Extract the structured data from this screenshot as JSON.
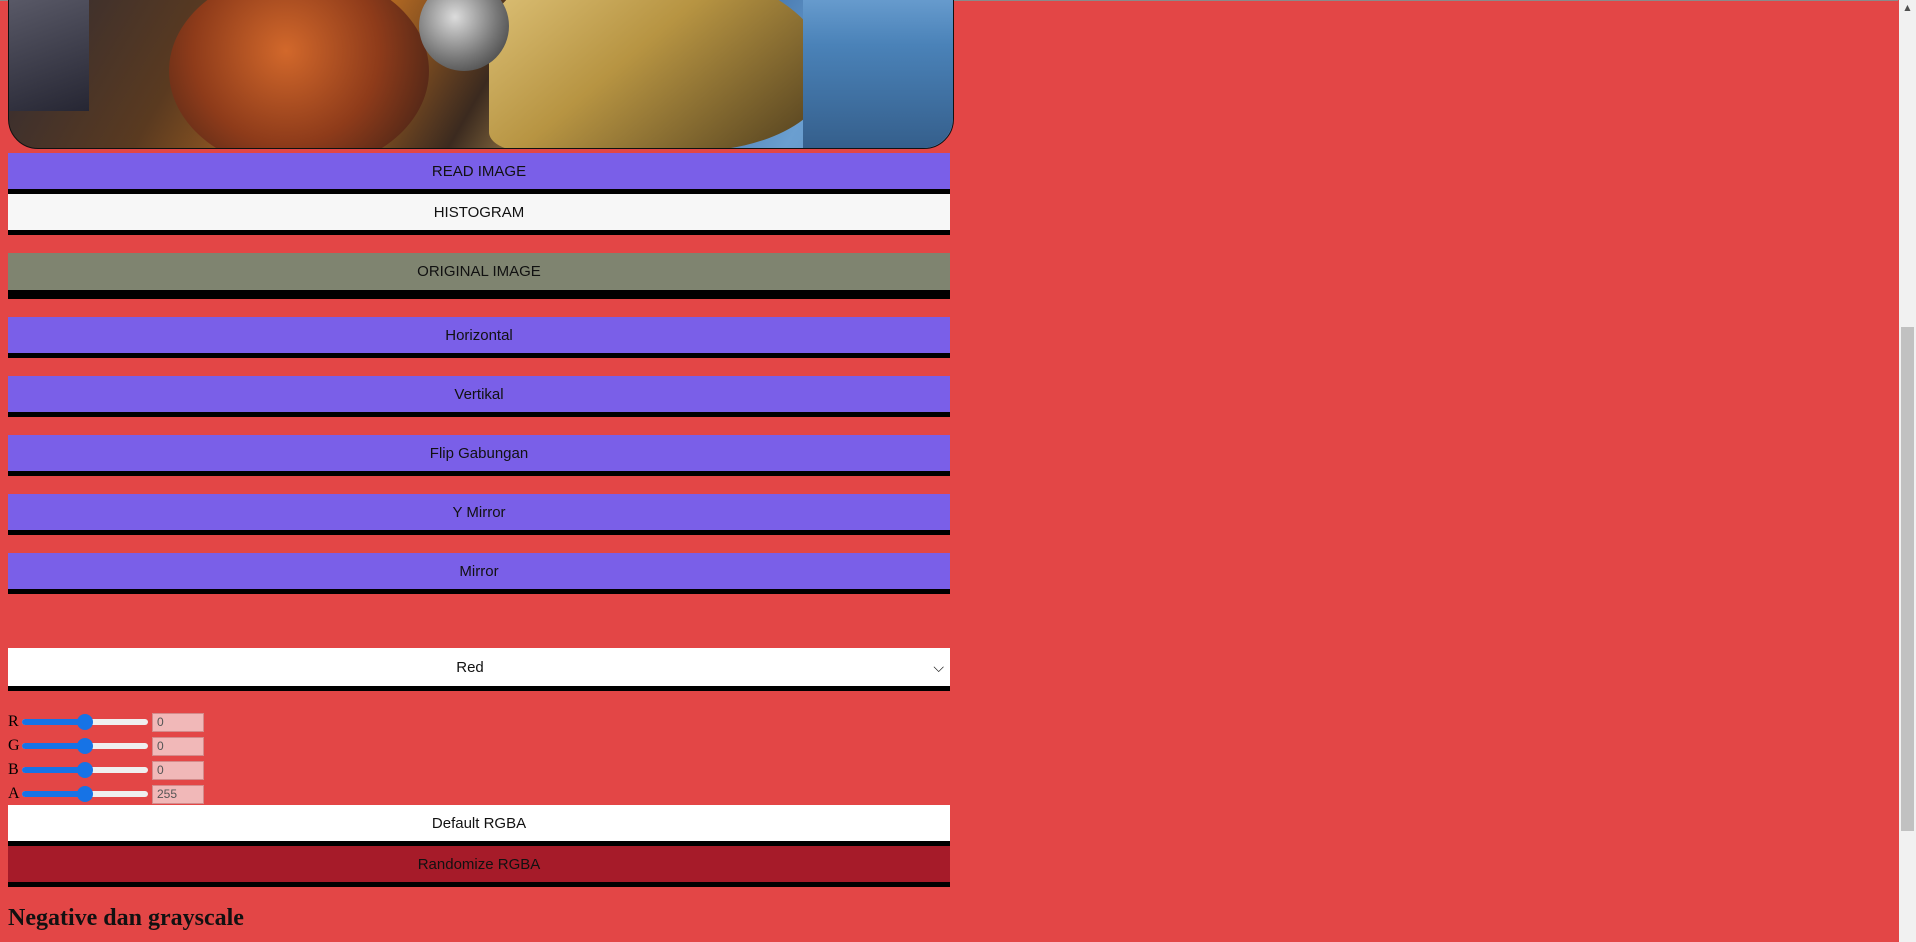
{
  "buttons": {
    "read_image": "READ IMAGE",
    "histogram": "HISTOGRAM",
    "original_image": "ORIGINAL IMAGE",
    "horizontal": "Horizontal",
    "vertikal": "Vertikal",
    "flip_gabungan": "Flip Gabungan",
    "y_mirror": "Y Mirror",
    "mirror": "Mirror",
    "default_rgba": "Default RGBA",
    "randomize_rgba": "Randomize RGBA"
  },
  "select": {
    "value": "Red"
  },
  "sliders": [
    {
      "label": "R",
      "value": "0",
      "fraction": 0.5
    },
    {
      "label": "G",
      "value": "0",
      "fraction": 0.5
    },
    {
      "label": "B",
      "value": "0",
      "fraction": 0.5
    },
    {
      "label": "A",
      "value": "255",
      "fraction": 0.5
    }
  ],
  "sections": {
    "negative_heading": "Negative dan grayscale"
  },
  "colors": {
    "background": "#e34646",
    "primary_button": "#7a5fe8",
    "original_button": "#7f8470",
    "randomize_button": "#a61b29",
    "slider_accent": "#1673e6"
  }
}
